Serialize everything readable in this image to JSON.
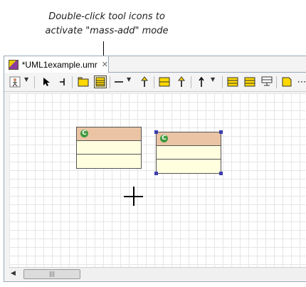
{
  "callout": {
    "line1": "Double-click tool icons to",
    "line2": "activate \"mass-add\" mode"
  },
  "editor": {
    "tab_title": "*UML1example.umr",
    "tab_icon": "uml-model-icon",
    "close_icon": "close-tab-icon"
  },
  "toolbar": {
    "items": [
      {
        "name": "person-dropdown-icon"
      },
      {
        "name": "select-arrow-icon"
      },
      {
        "name": "anchor-icon"
      },
      {
        "name": "package-icon"
      },
      {
        "name": "class-icon",
        "selected": true
      },
      {
        "name": "line-dropdown-icon"
      },
      {
        "name": "arrow-up-icon"
      },
      {
        "name": "interface-icon"
      },
      {
        "name": "dependency-arrow-icon"
      },
      {
        "name": "generalization-dropdown-icon"
      },
      {
        "name": "class-alt-icon"
      },
      {
        "name": "class-alt2-icon"
      },
      {
        "name": "signal-icon"
      },
      {
        "name": "note-icon"
      },
      {
        "name": "more-icon"
      }
    ],
    "more_label": "⋯"
  },
  "diagram": {
    "class_badge": "C",
    "accent_colors": {
      "class_header": "#eac4a4",
      "class_body": "#ffffe0",
      "handle": "#3d3dac"
    }
  },
  "scrollbar": {
    "left_arrow": "◀",
    "thumb_grip": "|||"
  }
}
